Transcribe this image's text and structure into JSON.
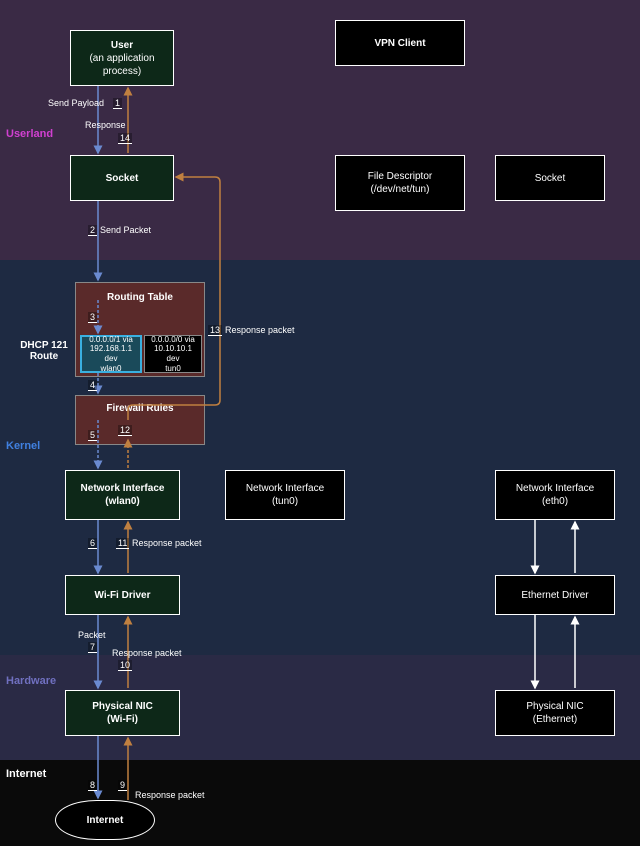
{
  "layers": {
    "userland": {
      "label": "Userland",
      "color": "#d040d0"
    },
    "kernel": {
      "label": "Kernel",
      "color": "#4080e0"
    },
    "hardware": {
      "label": "Hardware",
      "color": "#7070c0"
    },
    "internet": {
      "label": "Internet",
      "color": "#ffffff"
    }
  },
  "nodes": {
    "user": {
      "line1": "User",
      "line2": "(an application",
      "line3": "process)"
    },
    "vpn_client": "VPN Client",
    "socket_left": "Socket",
    "file_descriptor": {
      "line1": "File Descriptor",
      "line2": "(/dev/net/tun)"
    },
    "socket_right": "Socket",
    "routing_table": "Routing Table",
    "route1": {
      "line1": "0.0.0.0/1 via",
      "line2": "192.168.1.1 dev",
      "line3": "wlan0"
    },
    "route2": {
      "line1": "0.0.0.0/0 via",
      "line2": "10.10.10.1 dev",
      "line3": "tun0"
    },
    "dhcp_label": {
      "line1": "DHCP 121",
      "line2": "Route"
    },
    "firewall": "Firewall Rules",
    "ni_wlan0": {
      "line1": "Network Interface",
      "line2": "(wlan0)"
    },
    "ni_tun0": {
      "line1": "Network Interface",
      "line2": "(tun0)"
    },
    "ni_eth0": {
      "line1": "Network Interface",
      "line2": "(eth0)"
    },
    "wifi_driver": "Wi-Fi Driver",
    "eth_driver": "Ethernet Driver",
    "nic_wifi": {
      "line1": "Physical NIC",
      "line2": "(Wi-Fi)"
    },
    "nic_eth": {
      "line1": "Physical NIC",
      "line2": "(Ethernet)"
    },
    "internet_cloud": "Internet"
  },
  "flows": {
    "send_payload": "Send Payload",
    "response": "Response",
    "send_packet": "Send Packet",
    "response_packet": "Response packet",
    "packet": "Packet"
  },
  "steps": {
    "s1": "1",
    "s2": "2",
    "s3": "3",
    "s4": "4",
    "s5": "5",
    "s6": "6",
    "s7": "7",
    "s8": "8",
    "s9": "9",
    "s10": "10",
    "s11": "11",
    "s12": "12",
    "s13": "13",
    "s14": "14"
  }
}
